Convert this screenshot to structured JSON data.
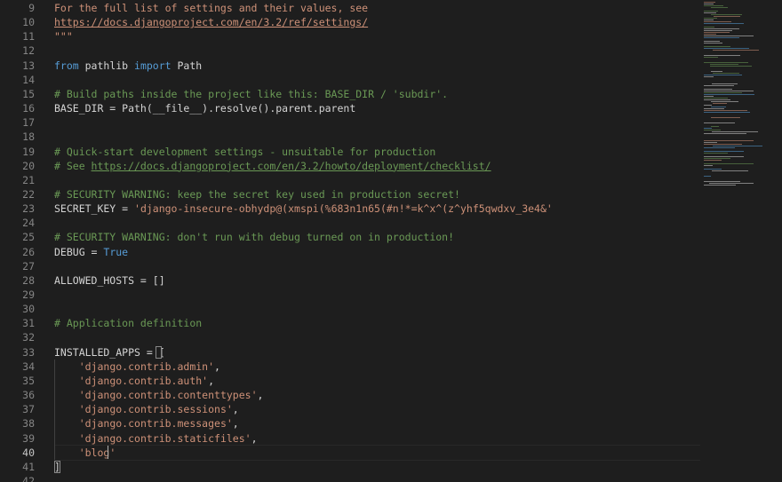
{
  "editor": {
    "active_line": 40,
    "line_numbers": [
      "9",
      "10",
      "11",
      "12",
      "13",
      "14",
      "15",
      "16",
      "17",
      "18",
      "19",
      "20",
      "21",
      "22",
      "23",
      "24",
      "25",
      "26",
      "27",
      "28",
      "29",
      "30",
      "31",
      "32",
      "33",
      "34",
      "35",
      "36",
      "37",
      "38",
      "39",
      "40",
      "41",
      "42"
    ],
    "lines": [
      [
        {
          "t": "For the full list of settings and their values, see",
          "c": "str"
        }
      ],
      [
        {
          "t": "https://docs.djangoproject.com/en/3.2/ref/settings/",
          "c": "link"
        }
      ],
      [
        {
          "t": "\"\"\"",
          "c": "str"
        }
      ],
      [],
      [
        {
          "t": "from",
          "c": "kw"
        },
        {
          "t": " pathlib ",
          "c": ""
        },
        {
          "t": "import",
          "c": "kw"
        },
        {
          "t": " Path",
          "c": ""
        }
      ],
      [],
      [
        {
          "t": "# Build paths inside the project like this: BASE_DIR / 'subdir'.",
          "c": "cm"
        }
      ],
      [
        {
          "t": "BASE_DIR = Path(__file__).resolve().parent.parent",
          "c": ""
        }
      ],
      [],
      [],
      [
        {
          "t": "# Quick-start development settings - unsuitable for production",
          "c": "cm"
        }
      ],
      [
        {
          "t": "# See ",
          "c": "cm"
        },
        {
          "t": "https://docs.djangoproject.com/en/3.2/howto/deployment/checklist/",
          "c": "linkcm"
        }
      ],
      [],
      [
        {
          "t": "# SECURITY WARNING: keep the secret key used in production secret!",
          "c": "cm"
        }
      ],
      [
        {
          "t": "SECRET_KEY = ",
          "c": ""
        },
        {
          "t": "'django-insecure-obhydp@(xmspi(%683n1n65(#n!*=k^x^(z^yhf5qwdxv_3e4&'",
          "c": "str"
        }
      ],
      [],
      [
        {
          "t": "# SECURITY WARNING: don't run with debug turned on in production!",
          "c": "cm"
        }
      ],
      [
        {
          "t": "DEBUG = ",
          "c": ""
        },
        {
          "t": "True",
          "c": "kw"
        }
      ],
      [],
      [
        {
          "t": "ALLOWED_HOSTS = []",
          "c": ""
        }
      ],
      [],
      [],
      [
        {
          "t": "# Application definition",
          "c": "cm"
        }
      ],
      [],
      [
        {
          "t": "INSTALLED_APPS = [",
          "c": ""
        }
      ],
      [
        {
          "t": "    ",
          "c": ""
        },
        {
          "t": "'django.contrib.admin'",
          "c": "str"
        },
        {
          "t": ",",
          "c": ""
        }
      ],
      [
        {
          "t": "    ",
          "c": ""
        },
        {
          "t": "'django.contrib.auth'",
          "c": "str"
        },
        {
          "t": ",",
          "c": ""
        }
      ],
      [
        {
          "t": "    ",
          "c": ""
        },
        {
          "t": "'django.contrib.contenttypes'",
          "c": "str"
        },
        {
          "t": ",",
          "c": ""
        }
      ],
      [
        {
          "t": "    ",
          "c": ""
        },
        {
          "t": "'django.contrib.sessions'",
          "c": "str"
        },
        {
          "t": ",",
          "c": ""
        }
      ],
      [
        {
          "t": "    ",
          "c": ""
        },
        {
          "t": "'django.contrib.messages'",
          "c": "str"
        },
        {
          "t": ",",
          "c": ""
        }
      ],
      [
        {
          "t": "    ",
          "c": ""
        },
        {
          "t": "'django.contrib.staticfiles'",
          "c": "str"
        },
        {
          "t": ",",
          "c": ""
        }
      ],
      [
        {
          "t": "    ",
          "c": ""
        },
        {
          "t": "'blog'",
          "c": "str"
        }
      ],
      [
        {
          "t": "]",
          "c": ""
        }
      ],
      []
    ]
  },
  "colors": {
    "background": "#1e1e1e",
    "keyword": "#569cd6",
    "string": "#ce9178",
    "comment": "#6a9955",
    "text": "#d4d4d4",
    "line_number": "#858585"
  }
}
